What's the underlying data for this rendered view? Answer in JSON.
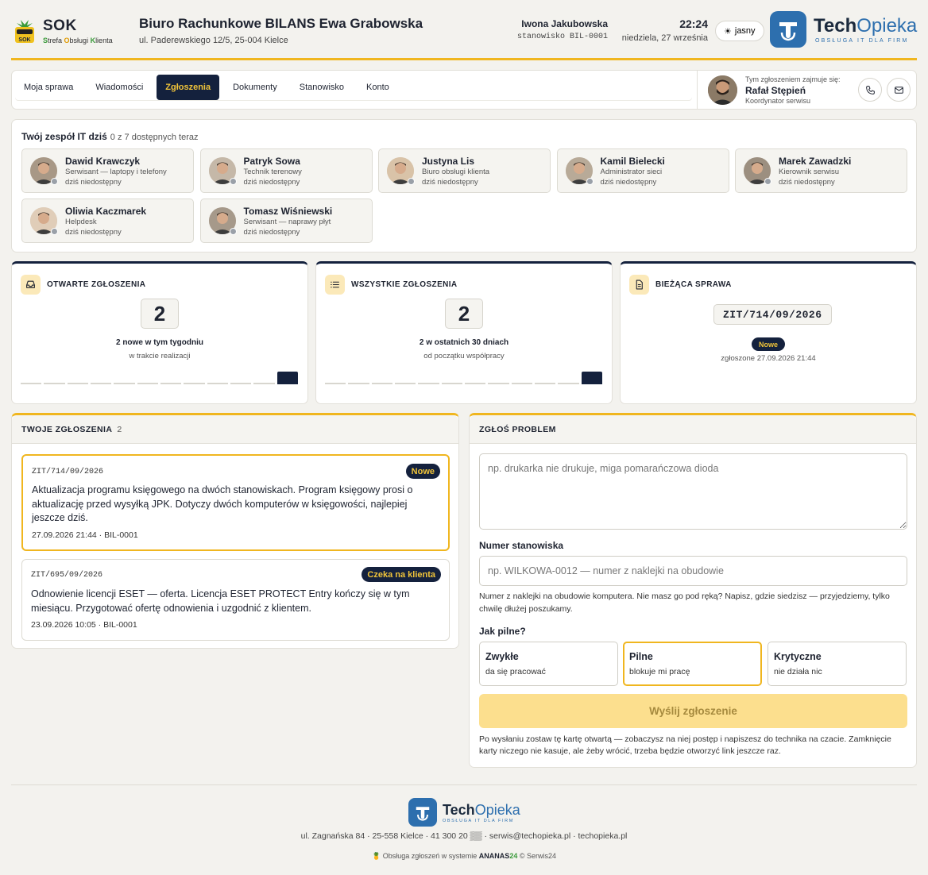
{
  "brand": {
    "name": "SOK",
    "sub_parts": [
      "S",
      "trefa ",
      "O",
      "bsługi ",
      "K",
      "lienta"
    ],
    "badge": "SOK"
  },
  "company": {
    "name": "Biuro Rachunkowe BILANS Ewa Grabowska",
    "address": "ul. Paderewskiego 12/5, 25-004 Kielce"
  },
  "user": {
    "name": "Iwona Jakubowska",
    "station": "stanowisko BIL-0001"
  },
  "clock": {
    "time": "22:24",
    "date": "niedziela, 27 września"
  },
  "theme_button": {
    "icon": "sun-icon",
    "label": "jasny"
  },
  "tech": {
    "name_bold": "Tech",
    "name_light": "Opieka",
    "tagline": "OBSŁUGA IT DLA FIRM"
  },
  "nav": {
    "tabs": [
      {
        "label": "Moja sprawa"
      },
      {
        "label": "Wiadomości"
      },
      {
        "label": "Zgłoszenia",
        "active": true
      },
      {
        "label": "Dokumenty"
      },
      {
        "label": "Stanowisko"
      },
      {
        "label": "Konto"
      }
    ]
  },
  "coordinator": {
    "lead": "Tym zgłoszeniem zajmuje się:",
    "name": "Rafał Stępień",
    "role": "Koordynator serwisu"
  },
  "team": {
    "title": "Twój zespół IT dziś",
    "availability": "0 z 7 dostępnych teraz",
    "members": [
      {
        "name": "Dawid Krawczyk",
        "role": "Serwisant — laptopy i telefony",
        "status": "dziś niedostępny"
      },
      {
        "name": "Patryk Sowa",
        "role": "Technik terenowy",
        "status": "dziś niedostępny"
      },
      {
        "name": "Justyna Lis",
        "role": "Biuro obsługi klienta",
        "status": "dziś niedostępny"
      },
      {
        "name": "Kamil Bielecki",
        "role": "Administrator sieci",
        "status": "dziś niedostępny"
      },
      {
        "name": "Marek Zawadzki",
        "role": "Kierownik serwisu",
        "status": "dziś niedostępny"
      },
      {
        "name": "Oliwia Kaczmarek",
        "role": "Helpdesk",
        "status": "dziś niedostępny"
      },
      {
        "name": "Tomasz Wiśniewski",
        "role": "Serwisant — naprawy płyt",
        "status": "dziś niedostępny"
      }
    ]
  },
  "stats": {
    "open": {
      "title": "OTWARTE ZGŁOSZENIA",
      "value": "2",
      "line1": "2 nowe w tym tygodniu",
      "line2": "w trakcie realizacji",
      "spark": [
        0,
        0,
        0,
        0,
        0,
        0,
        0,
        0,
        0,
        0,
        0,
        2
      ]
    },
    "all": {
      "title": "WSZYSTKIE ZGŁOSZENIA",
      "value": "2",
      "line1": "2 w ostatnich 30 dniach",
      "line2": "od początku współpracy",
      "spark": [
        0,
        0,
        0,
        0,
        0,
        0,
        0,
        0,
        0,
        0,
        0,
        2
      ]
    },
    "current": {
      "title": "BIEŻĄCA SPRAWA",
      "case_id": "ZIT/714/09/2026",
      "badge": "Nowe",
      "date": "zgłoszone 27.09.2026 21:44"
    }
  },
  "tickets": {
    "title": "TWOJE ZGŁOSZENIA",
    "count": "2",
    "items": [
      {
        "id": "ZIT/714/09/2026",
        "badge": "Nowe",
        "body": "Aktualizacja programu księgowego na dwóch stanowiskach. Program księgowy prosi o aktualizację przed wysyłką JPK. Dotyczy dwóch komputerów w księgowości, najlepiej jeszcze dziś.",
        "meta": "27.09.2026 21:44 · BIL-0001"
      },
      {
        "id": "ZIT/695/09/2026",
        "badge": "Czeka na klienta",
        "body": "Odnowienie licencji ESET — oferta. Licencja ESET PROTECT Entry kończy się w tym miesiącu. Przygotować ofertę odnowienia i uzgodnić z klientem.",
        "meta": "23.09.2026 10:05 · BIL-0001"
      }
    ]
  },
  "report": {
    "title": "ZGŁOŚ PROBLEM",
    "description_placeholder": "np. drukarka nie drukuje, miga pomarańczowa dioda",
    "station_label": "Numer stanowiska",
    "station_placeholder": "np. WILKOWA-0012 — numer z naklejki na obudowie",
    "station_help": "Numer z naklejki na obudowie komputera. Nie masz go pod ręką? Napisz, gdzie siedzisz — przyjedziemy, tylko chwilę dłużej poszukamy.",
    "urgency_label": "Jak pilne?",
    "urgency": [
      {
        "title": "Zwykłe",
        "sub": "da się pracować"
      },
      {
        "title": "Pilne",
        "sub": "blokuje mi pracę",
        "selected": true
      },
      {
        "title": "Krytyczne",
        "sub": "nie działa nic"
      }
    ],
    "submit": "Wyślij zgłoszenie",
    "note": "Po wysłaniu zostaw tę kartę otwartą — zobaczysz na niej postęp i napiszesz do technika na czacie. Zamknięcie karty niczego nie kasuje, ale żeby wrócić, trzeba będzie otworzyć link jeszcze raz."
  },
  "footer": {
    "name_bold": "Tech",
    "name_light": "Opieka",
    "tagline": "OBSŁUGA IT DLA FIRM",
    "contact": "ul. Zagnańska 84 · 25-558 Kielce · 41 300 20 ▒▒ · serwis@techopieka.pl · techopieka.pl",
    "powered_pre": "Obsługa zgłoszeń w systemie ",
    "powered_brand": "ANANAS",
    "powered_num": "24",
    "powered_post": " © Serwis24"
  },
  "colors": {
    "navy": "#14213d",
    "accent": "#f0b61f",
    "tech_blue": "#2d6fae",
    "status_offline": "#9aa0a8"
  }
}
